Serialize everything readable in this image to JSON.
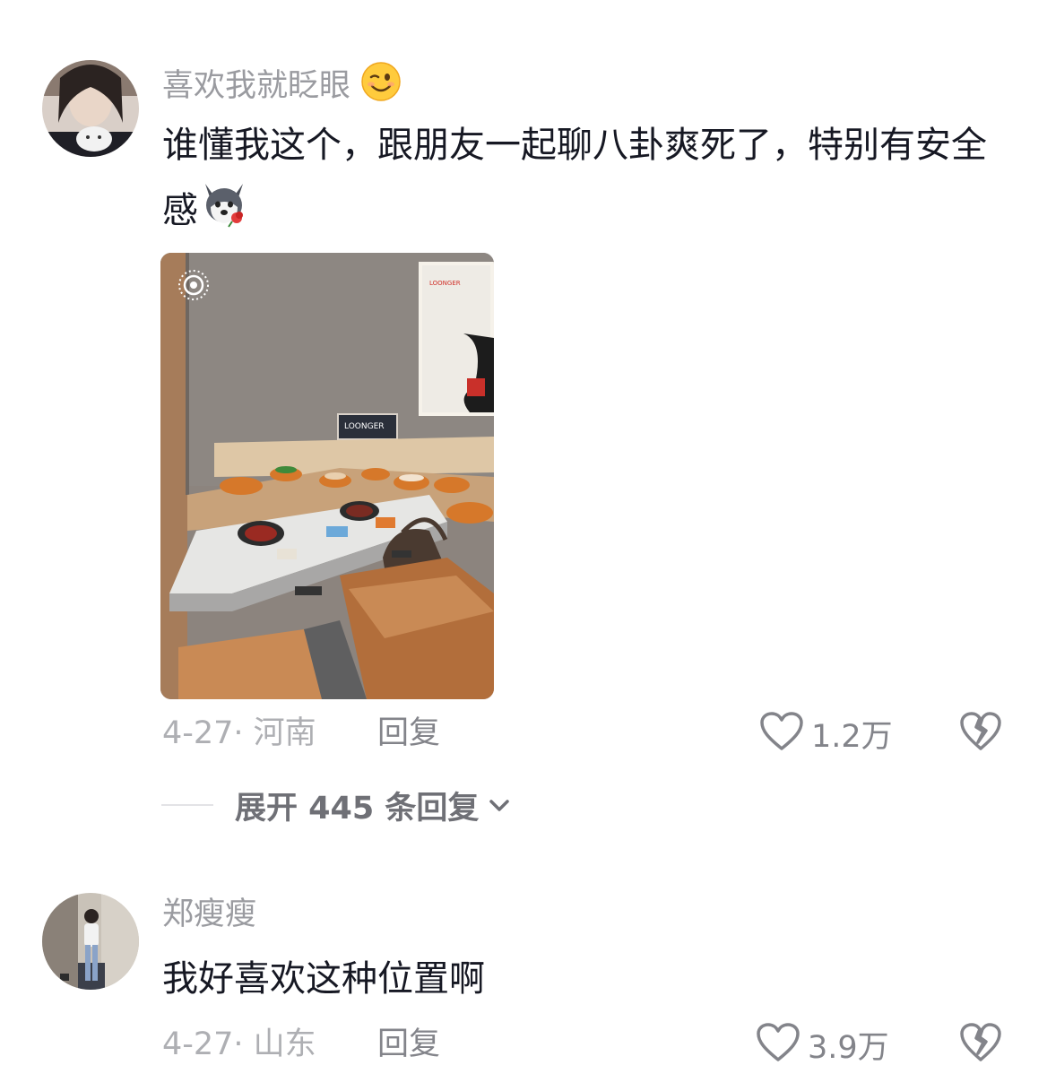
{
  "comments": [
    {
      "username": "喜欢我就眨眼",
      "username_emoji": "wink-emoji",
      "text": "谁懂我这个，跟朋友一起聊八卦爽死了，特别有安全感",
      "text_emoji": "husky-rose-emoji",
      "image_alt": "hotpot-conveyor-booth-photo",
      "image_sign": "LOONGER",
      "date_location": "4-27· 河南",
      "reply_label": "回复",
      "like_count": "1.2万",
      "expand_label": "展开 445 条回复"
    },
    {
      "username": "郑瘦瘦",
      "text": "我好喜欢这种位置啊",
      "date_location": "4-27· 山东",
      "reply_label": "回复",
      "like_count": "3.9万"
    }
  ],
  "icons": {
    "like": "heart-outline-icon",
    "dislike": "broken-heart-icon",
    "expand": "chevron-down-icon",
    "live": "live-photo-icon"
  },
  "colors": {
    "text": "#161823",
    "username": "#9a9ba0",
    "meta": "#aeafb3",
    "action": "#83848a"
  }
}
